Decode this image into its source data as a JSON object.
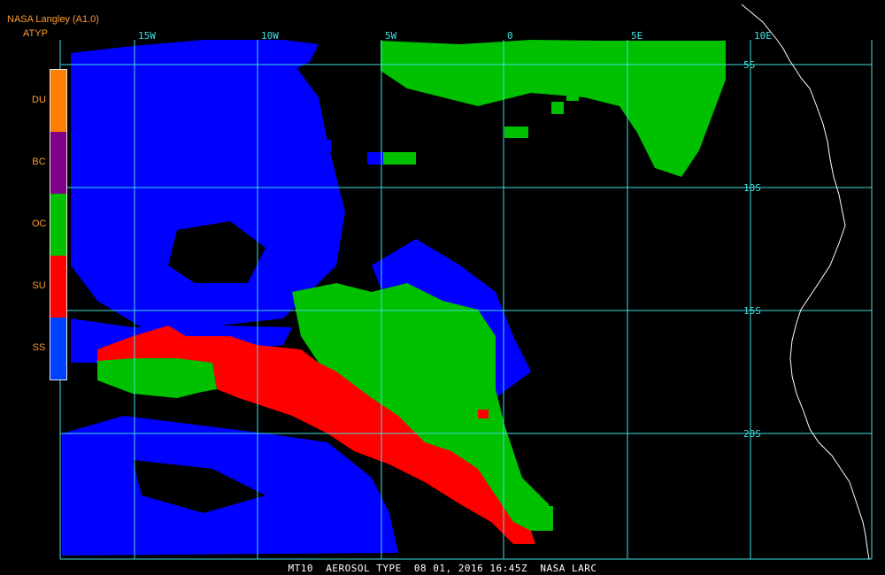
{
  "header": {
    "title": "NASA Langley (A1.0)",
    "product": "ATYP"
  },
  "legend": {
    "items": [
      {
        "code": "DU",
        "color": "#ff8000"
      },
      {
        "code": "BC",
        "color": "#80008a"
      },
      {
        "code": "OC",
        "color": "#00c000"
      },
      {
        "code": "SU",
        "color": "#ff0000"
      },
      {
        "code": "SS",
        "color": "#0040ff"
      }
    ]
  },
  "map": {
    "lon_labels": [
      "15W",
      "10W",
      "5W",
      "0",
      "5E",
      "10E"
    ],
    "lat_labels": [
      "5S",
      "10S",
      "15S",
      "20S"
    ],
    "grid_color": "#40e0e0",
    "coast_color": "#ffffff"
  },
  "footer": {
    "text": "MT10  AEROSOL TYPE  08 01, 2016 16:45Z  NASA LARC"
  }
}
